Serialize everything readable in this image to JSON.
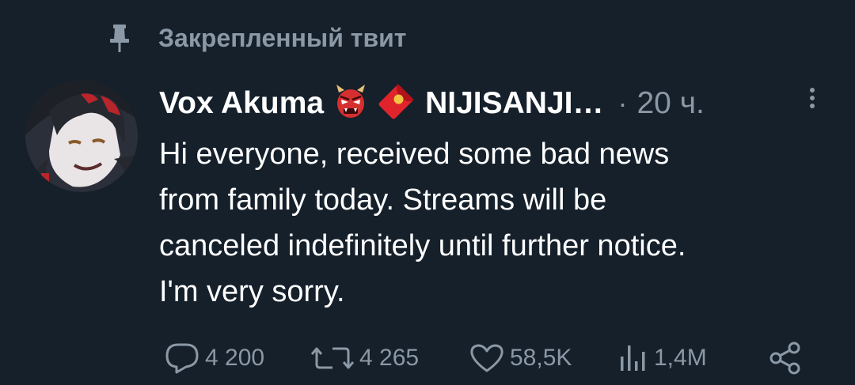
{
  "pinned": {
    "label": "Закрепленный твит",
    "icon": "pin-icon"
  },
  "tweet": {
    "author_name": "Vox Akuma",
    "author_emoji_1": "oni-mask-icon",
    "author_emoji_2": "red-envelope-icon",
    "handle_truncated": "NIJISANJI…",
    "separator": "·",
    "time": "20 ч.",
    "text_lines": [
      "Hi everyone, received some bad news",
      "from family today. Streams will be",
      "canceled indefinitely until further notice.",
      "I'm very sorry."
    ]
  },
  "actions": {
    "reply_count": "4 200",
    "retweet_count": "4 265",
    "like_count": "58,5K",
    "views_count": "1,4M"
  },
  "colors": {
    "background": "#15202b",
    "muted": "#8b98a5",
    "text": "#ffffff"
  }
}
